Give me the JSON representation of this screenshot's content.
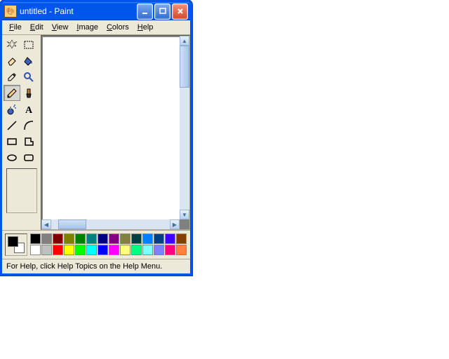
{
  "title": "untitled - Paint",
  "menu": [
    "File",
    "Edit",
    "View",
    "Image",
    "Colors",
    "Help"
  ],
  "tools": [
    {
      "name": "free-select",
      "icon": "star"
    },
    {
      "name": "rect-select",
      "icon": "rectsel"
    },
    {
      "name": "eraser",
      "icon": "eraser"
    },
    {
      "name": "fill",
      "icon": "bucket"
    },
    {
      "name": "picker",
      "icon": "dropper"
    },
    {
      "name": "magnifier",
      "icon": "magnify"
    },
    {
      "name": "pencil",
      "icon": "pencil",
      "selected": true
    },
    {
      "name": "brush",
      "icon": "brush"
    },
    {
      "name": "airbrush",
      "icon": "spray"
    },
    {
      "name": "text",
      "icon": "text"
    },
    {
      "name": "line",
      "icon": "line"
    },
    {
      "name": "curve",
      "icon": "curve"
    },
    {
      "name": "rectangle",
      "icon": "rect"
    },
    {
      "name": "polygon",
      "icon": "poly"
    },
    {
      "name": "ellipse",
      "icon": "ellipse"
    },
    {
      "name": "round-rect",
      "icon": "rrect"
    }
  ],
  "fg_color": "#000000",
  "bg_color": "#ffffff",
  "palette": [
    "#000000",
    "#808080",
    "#800000",
    "#808000",
    "#008000",
    "#008080",
    "#000080",
    "#800080",
    "#808040",
    "#004040",
    "#0080ff",
    "#004080",
    "#4000ff",
    "#804000",
    "#ffffff",
    "#c0c0c0",
    "#ff0000",
    "#ffff00",
    "#00ff00",
    "#00ffff",
    "#0000ff",
    "#ff00ff",
    "#ffff80",
    "#00ff80",
    "#80ffff",
    "#8080ff",
    "#ff0080",
    "#ff8040"
  ],
  "status": "For Help, click Help Topics on the Help Menu."
}
